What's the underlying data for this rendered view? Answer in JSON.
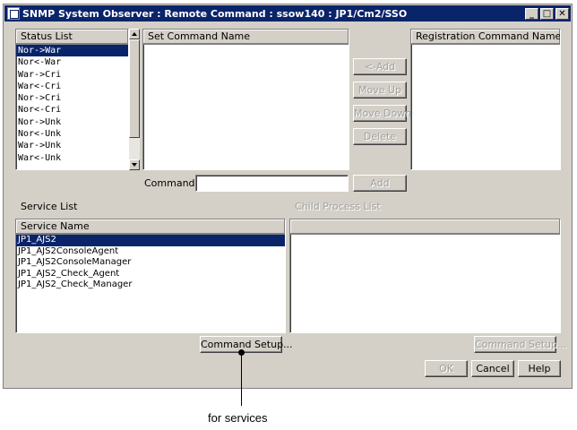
{
  "window": {
    "title": "SNMP System Observer : Remote Command : ssow140 : JP1/Cm2/SSO",
    "minimize": "_",
    "maximize": "□",
    "close": "✕"
  },
  "status_list": {
    "header": "Status List",
    "items": [
      "Nor->War",
      "Nor<-War",
      "War->Cri",
      "War<-Cri",
      "Nor->Cri",
      "Nor<-Cri",
      "Nor->Unk",
      "Nor<-Unk",
      "War->Unk",
      "War<-Unk"
    ],
    "selected_index": 0
  },
  "set_command": {
    "header": "Set Command Name"
  },
  "registration": {
    "header": "Registration Command Name"
  },
  "buttons": {
    "add_left": "<-Add",
    "move_up": "Move Up",
    "move_down": "Move Down",
    "delete": "Delete",
    "add": "Add",
    "command_setup_services": "Command Setup...",
    "command_setup_child": "Command Setup...",
    "ok": "OK",
    "cancel": "Cancel",
    "help": "Help"
  },
  "command": {
    "label": "Command",
    "value": ""
  },
  "service_list": {
    "label": "Service List",
    "header": "Service Name",
    "items": [
      "JP1_AJS2",
      "JP1_AJS2ConsoleAgent",
      "JP1_AJS2ConsoleManager",
      "JP1_AJS2_Check_Agent",
      "JP1_AJS2_Check_Manager"
    ],
    "selected_index": 0
  },
  "child_process": {
    "label": "Child Process List",
    "header": ""
  },
  "annotation": {
    "text": "for services"
  }
}
